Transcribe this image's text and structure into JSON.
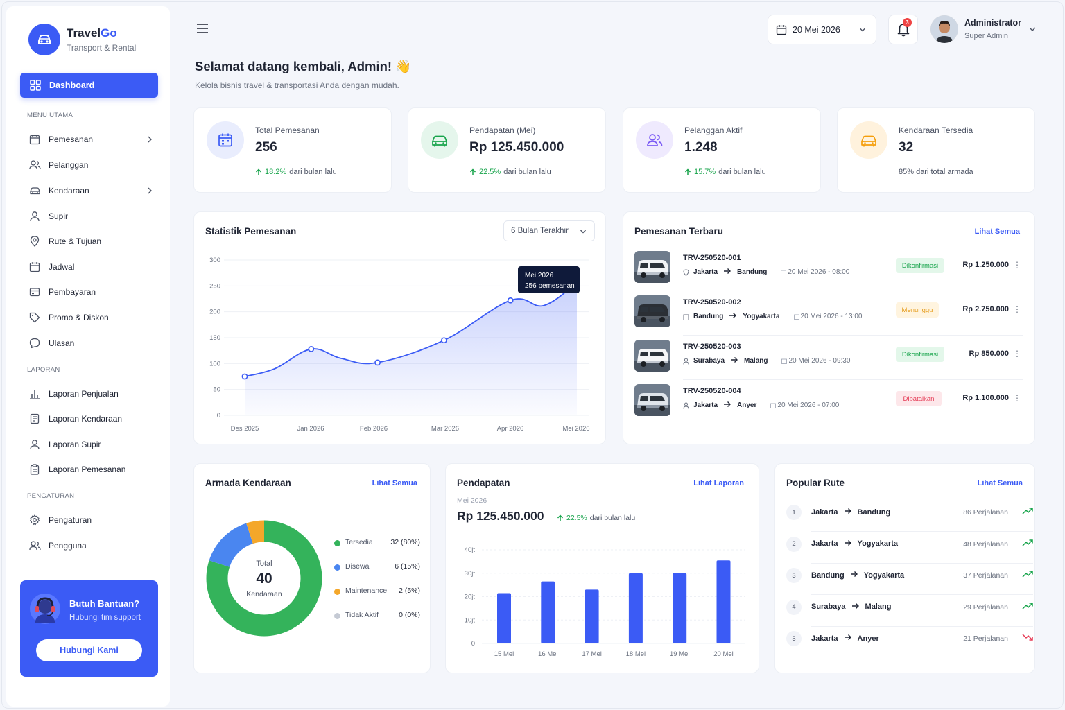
{
  "brand": {
    "name_main": "Travel",
    "name_accent": "Go",
    "subtitle": "Transport & Rental"
  },
  "sidebar": {
    "active": "Dashboard",
    "sections": {
      "main": "MENU UTAMA",
      "reports": "LAPORAN",
      "settings": "PENGATURAN"
    },
    "items": [
      "Pemesanan",
      "Pelanggan",
      "Kendaraan",
      "Supir",
      "Rute & Tujuan",
      "Jadwal",
      "Pembayaran",
      "Promo & Diskon",
      "Ulasan"
    ],
    "report_items": [
      "Laporan Penjualan",
      "Laporan Kendaraan",
      "Laporan Supir",
      "Laporan Pemesanan"
    ],
    "setting_items": [
      "Pengaturan",
      "Pengguna"
    ],
    "help": {
      "title": "Butuh Bantuan?",
      "subtitle": "Hubungi tim support",
      "button": "Hubungi Kami"
    }
  },
  "header": {
    "date": "20 Mei 2026",
    "notif_count": "3",
    "user_name": "Administrator",
    "user_role": "Super Admin"
  },
  "welcome": {
    "title": "Selamat datang kembali, Admin! 👋",
    "subtitle": "Kelola bisnis travel & transportasi Anda dengan mudah."
  },
  "stats": [
    {
      "label": "Total Pemesanan",
      "value": "256",
      "pct": "18.2%",
      "trend": "dari bulan lalu",
      "color": "#3b5bf5",
      "bg": "#e9edfd"
    },
    {
      "label": "Pendapatan (Mei)",
      "value": "Rp 125.450.000",
      "pct": "22.5%",
      "trend": "dari bulan lalu",
      "color": "#16a34a",
      "bg": "#e5f6ec"
    },
    {
      "label": "Pelanggan Aktif",
      "value": "1.248",
      "pct": "15.7%",
      "trend": "dari bulan lalu",
      "color": "#7c5cf5",
      "bg": "#efeafe"
    },
    {
      "label": "Kendaraan Tersedia",
      "value": "32",
      "note": "85% dari total armada",
      "color": "#f59e0b",
      "bg": "#fff2dd"
    }
  ],
  "booking_stats": {
    "title": "Statistik Pemesanan",
    "filter": "6 Bulan Terakhir",
    "tooltip_title": "Mei 2026",
    "tooltip_value": "256 pemesanan"
  },
  "recent": {
    "title": "Pemesanan Terbaru",
    "link": "Lihat Semua",
    "rows": [
      {
        "code": "TRV-250520-001",
        "from": "Jakarta",
        "to": "Bandung",
        "when": "20 Mei 2026 - 08:00",
        "status": "Dikonfirmasi",
        "status_type": "ok",
        "price": "Rp 1.250.000"
      },
      {
        "code": "TRV-250520-002",
        "from": "Bandung",
        "to": "Yogyakarta",
        "when": "20 Mei 2026 - 13:00",
        "status": "Menunggu",
        "status_type": "wait",
        "price": "Rp 2.750.000"
      },
      {
        "code": "TRV-250520-003",
        "from": "Surabaya",
        "to": "Malang",
        "when": "20 Mei 2026 - 09:30",
        "status": "Dikonfirmasi",
        "status_type": "ok",
        "price": "Rp 850.000"
      },
      {
        "code": "TRV-250520-004",
        "from": "Jakarta",
        "to": "Anyer",
        "when": "20 Mei 2026 - 07:00",
        "status": "Dibatalkan",
        "status_type": "cancel",
        "price": "Rp 1.100.000"
      }
    ]
  },
  "fleet": {
    "title": "Armada Kendaraan",
    "link": "Lihat Semua",
    "center_label": "Total",
    "center_value": "40",
    "center_unit": "Kendaraan"
  },
  "revenue": {
    "title": "Pendapatan",
    "link": "Lihat Laporan",
    "period": "Mei 2026",
    "value": "Rp 125.450.000",
    "pct": "22.5%",
    "trend": "dari bulan lalu"
  },
  "routes": {
    "title": "Popular Rute",
    "link": "Lihat Semua",
    "rows": [
      {
        "n": "1",
        "from": "Jakarta",
        "to": "Bandung",
        "trips": "86 Perjalanan",
        "up": true
      },
      {
        "n": "2",
        "from": "Jakarta",
        "to": "Yogyakarta",
        "trips": "48 Perjalanan",
        "up": true
      },
      {
        "n": "3",
        "from": "Bandung",
        "to": "Yogyakarta",
        "trips": "37 Perjalanan",
        "up": true
      },
      {
        "n": "4",
        "from": "Surabaya",
        "to": "Malang",
        "trips": "29 Perjalanan",
        "up": true
      },
      {
        "n": "5",
        "from": "Jakarta",
        "to": "Anyer",
        "trips": "21 Perjalanan",
        "up": false
      }
    ]
  },
  "chart_data": [
    {
      "type": "area",
      "title": "Statistik Pemesanan",
      "categories": [
        "Des 2025",
        "Jan 2026",
        "Feb 2026",
        "Mar 2026",
        "Apr 2026",
        "Mei 2026"
      ],
      "x_ticks": [
        "Des 2025",
        "Jan 2026",
        "Feb 2026",
        "Mar 2026",
        "Apr 2026",
        "Mei 2026"
      ],
      "y_ticks": [
        "300",
        "250",
        "200",
        "150",
        "100",
        "50",
        "0"
      ],
      "points": [
        {
          "x": 0,
          "y": 75,
          "marker": true
        },
        {
          "x": 0.45,
          "y": 90,
          "marker": false
        },
        {
          "x": 1,
          "y": 128,
          "marker": true
        },
        {
          "x": 1.45,
          "y": 110,
          "marker": false
        },
        {
          "x": 2,
          "y": 102,
          "marker": true
        },
        {
          "x": 3,
          "y": 145,
          "marker": true
        },
        {
          "x": 4,
          "y": 222,
          "marker": true
        },
        {
          "x": 4.5,
          "y": 212,
          "marker": false
        },
        {
          "x": 5,
          "y": 256,
          "marker": true
        }
      ],
      "ylim": [
        0,
        300
      ],
      "color": "#3b5bf5"
    },
    {
      "type": "pie",
      "title": "Armada Kendaraan",
      "slices": [
        {
          "label": "Tersedia",
          "value": 32,
          "display": "32 (80%)",
          "color": "#34b35b"
        },
        {
          "label": "Disewa",
          "value": 6,
          "display": "6 (15%)",
          "color": "#4a86f0"
        },
        {
          "label": "Maintenance",
          "value": 2,
          "display": "2 (5%)",
          "color": "#f4a72a"
        },
        {
          "label": "Tidak Aktif",
          "value": 0,
          "display": "0 (0%)",
          "color": "#c5cad4"
        }
      ]
    },
    {
      "type": "bar",
      "title": "Pendapatan",
      "categories": [
        "15 Mei",
        "16 Mei",
        "17 Mei",
        "18 Mei",
        "19 Mei",
        "20 Mei"
      ],
      "values": [
        21.5,
        26.5,
        23,
        30,
        30,
        35.5
      ],
      "y_ticks": [
        "40jt",
        "30jt",
        "20jt",
        "10jt",
        "0"
      ],
      "ylim": [
        0,
        40
      ],
      "color": "#3b5bf5"
    }
  ]
}
